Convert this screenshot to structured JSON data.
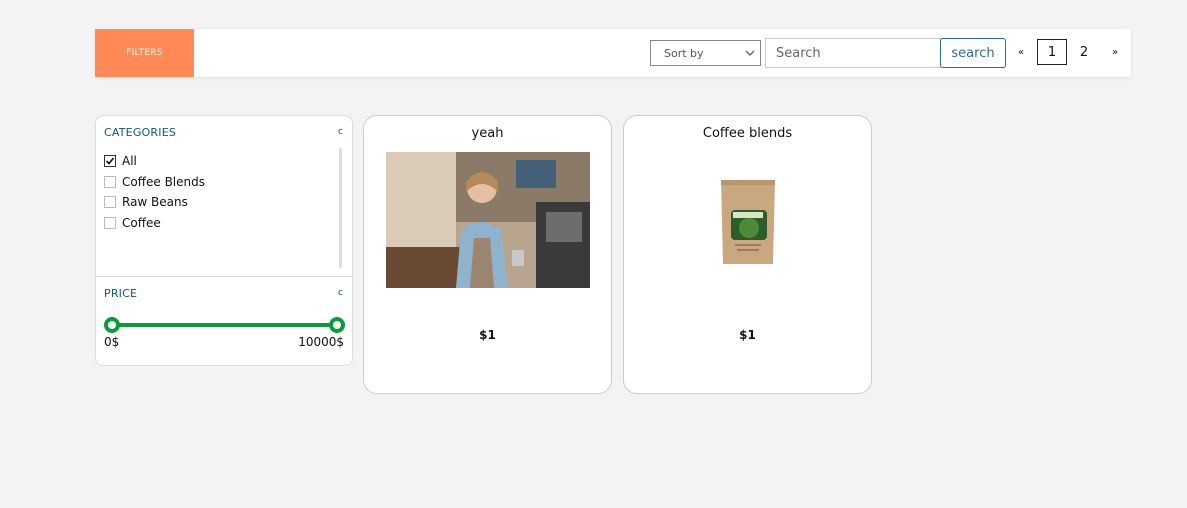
{
  "toolbar": {
    "filters_label": "FILTERS",
    "sort_selected": "Sort by",
    "search_placeholder": "Search",
    "search_button": "search",
    "pagination": {
      "prev": "«",
      "pages": [
        "1",
        "2"
      ],
      "current": "1",
      "next": "»"
    }
  },
  "sidebar": {
    "categories_title": "CATEGORIES",
    "categories_toggle": "c",
    "categories": [
      {
        "label": "All",
        "checked": true
      },
      {
        "label": "Coffee Blends",
        "checked": false
      },
      {
        "label": "Raw Beans",
        "checked": false
      },
      {
        "label": "Coffee",
        "checked": false
      }
    ],
    "price_title": "PRICE",
    "price_toggle": "c",
    "price_min": "0$",
    "price_max": "10000$"
  },
  "products": [
    {
      "title": "yeah",
      "price": "$1",
      "image": "barista-photo"
    },
    {
      "title": "Coffee blends",
      "price": "$1",
      "image": "coffee-bag-photo"
    }
  ],
  "colors": {
    "accent_orange": "#ff8a57",
    "teal_text": "#0e5a66",
    "slider_green": "#0b9b3a",
    "search_blue": "#2e6d8c",
    "background": "#f3f3f3"
  }
}
